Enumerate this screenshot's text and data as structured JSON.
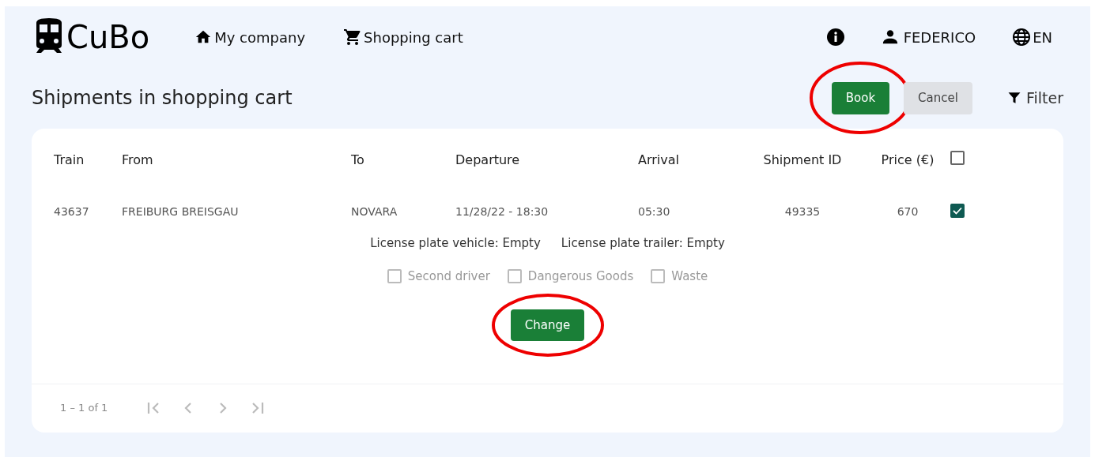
{
  "navbar": {
    "brand": "CuBo",
    "links": [
      {
        "label": "My company"
      },
      {
        "label": "Shopping cart"
      }
    ],
    "user": "FEDERICO",
    "language": "EN"
  },
  "page": {
    "title": "Shipments in shopping cart",
    "actions": [
      {
        "label": "Book",
        "kind": "primary",
        "circled": true
      },
      {
        "label": "Cancel",
        "kind": "secondary",
        "circled": false
      }
    ],
    "filter": "Filter"
  },
  "table": {
    "columns": [
      "Train",
      "From",
      "To",
      "Departure",
      "Arrival",
      "Shipment ID",
      "Price (€)"
    ],
    "select_all_checked": false,
    "rows": [
      {
        "cells": [
          "43637",
          "FREIBURG BREISGAU",
          "NOVARA",
          "11/28/22 - 18:30",
          "05:30",
          "49335",
          "670"
        ],
        "checked": true,
        "details": [
          "License plate vehicle: Empty",
          "License plate trailer: Empty"
        ],
        "options": [
          {
            "label": "Second driver",
            "checked": false,
            "disabled": true
          },
          {
            "label": "Dangerous Goods",
            "checked": false,
            "disabled": true
          },
          {
            "label": "Waste",
            "checked": false,
            "disabled": true
          }
        ],
        "change_button": {
          "label": "Change",
          "circled": true
        }
      }
    ]
  },
  "pagination": {
    "range": "1 – 1 of 1",
    "disabled": true
  }
}
